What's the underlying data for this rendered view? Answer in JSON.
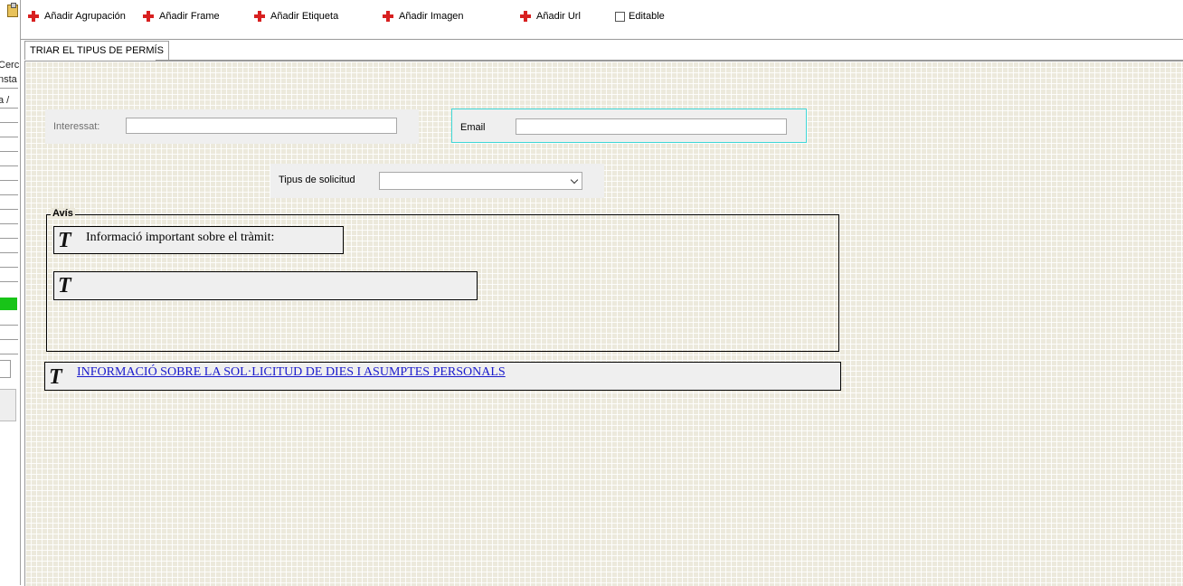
{
  "toolbar": {
    "buttons": [
      {
        "label": "Añadir Agrupación",
        "icon": "plus-icon"
      },
      {
        "label": "Añadir Frame",
        "icon": "plus-icon"
      },
      {
        "label": "Añadir Etiqueta",
        "icon": "plus-icon"
      },
      {
        "label": "Añadir Imagen",
        "icon": "plus-icon"
      },
      {
        "label": "Añadir Url",
        "icon": "plus-icon"
      }
    ],
    "editable_label": "Editable",
    "editable_checked": false
  },
  "left_panel": {
    "text_lines": [
      "Cerc",
      "nsta",
      "a  /"
    ]
  },
  "tabs": [
    {
      "label": "TRIAR EL TIPUS DE PERMÍS",
      "active": true
    }
  ],
  "form": {
    "interessat": {
      "label": "Interessat:",
      "value": ""
    },
    "email": {
      "label": "Email",
      "value": ""
    },
    "tipus_solicitud": {
      "label": "Tipus de solicitud",
      "selected": ""
    },
    "avis": {
      "title": "Avís",
      "text1": "Informació important sobre el tràmit:",
      "text2": ""
    },
    "link_text": "INFORMACIÓ SOBRE LA SOL·LICITUD DE DIES I ASUMPTES PERSONALS"
  },
  "colors": {
    "accent_plus": "#d82020",
    "canvas_bg": "#ece9dc",
    "email_highlight": "#3fd6d6",
    "link": "#1a1acc",
    "status_green": "#18c418"
  }
}
